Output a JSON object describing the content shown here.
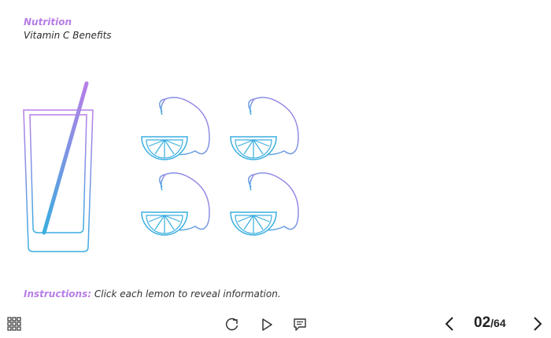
{
  "header": {
    "section": "Nutrition",
    "title": "Vitamin C Benefits"
  },
  "scene": {
    "glass_icon": "glass-with-straw-icon",
    "lemon_icon": "lemon-icon",
    "lemons": [
      "lemon-1",
      "lemon-2",
      "lemon-3",
      "lemon-4"
    ],
    "colors": {
      "gradient_start": "#b77ee6",
      "gradient_end": "#3aaee0"
    }
  },
  "instructions": {
    "label": "Instructions:",
    "text": "Click each lemon to reveal information."
  },
  "toolbar": {
    "menu_icon": "grid-menu-icon",
    "replay_icon": "replay-icon",
    "play_icon": "play-icon",
    "notes_icon": "notes-icon",
    "prev_icon": "chevron-left-icon",
    "next_icon": "chevron-right-icon",
    "page_current": "02",
    "page_total": "/64"
  }
}
